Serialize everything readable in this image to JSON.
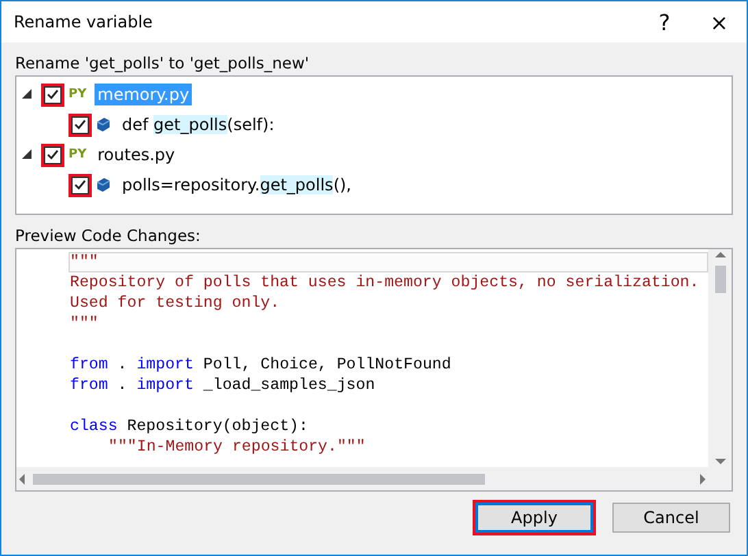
{
  "window": {
    "title": "Rename variable",
    "help": "?",
    "close": "×"
  },
  "rename_label": "Rename 'get_polls' to 'get_polls_new'",
  "tree": [
    {
      "name": "memory.py",
      "badge": "PY",
      "expanded": true,
      "checked": true,
      "highlighted": true,
      "selected": true,
      "children": [
        {
          "before": "def ",
          "match": "get_polls",
          "after": "(self):",
          "checked": true,
          "highlighted": true
        }
      ]
    },
    {
      "name": "routes.py",
      "badge": "PY",
      "expanded": true,
      "checked": true,
      "highlighted": true,
      "selected": false,
      "children": [
        {
          "before": "polls=repository.",
          "match": "get_polls",
          "after": "(),",
          "checked": true,
          "highlighted": true
        }
      ]
    }
  ],
  "preview_label": "Preview Code Changes:",
  "code_lines": [
    {
      "current": true,
      "tokens": [
        {
          "kind": "string",
          "text": "\"\"\""
        }
      ]
    },
    {
      "current": false,
      "tokens": [
        {
          "kind": "string",
          "text": "Repository of polls that uses in-memory objects, no serialization."
        }
      ]
    },
    {
      "current": false,
      "tokens": [
        {
          "kind": "string",
          "text": "Used for testing only."
        }
      ]
    },
    {
      "current": false,
      "tokens": [
        {
          "kind": "string",
          "text": "\"\"\""
        }
      ]
    },
    {
      "current": false
    },
    {
      "current": false,
      "tokens": [
        {
          "kind": "keyword",
          "text": "from"
        },
        {
          "kind": "plain",
          "text": " . "
        },
        {
          "kind": "keyword",
          "text": "import"
        },
        {
          "kind": "plain",
          "text": " Poll, Choice, PollNotFound"
        }
      ]
    },
    {
      "current": false,
      "tokens": [
        {
          "kind": "keyword",
          "text": "from"
        },
        {
          "kind": "plain",
          "text": " . "
        },
        {
          "kind": "keyword",
          "text": "import"
        },
        {
          "kind": "plain",
          "text": " _load_samples_json"
        }
      ]
    },
    {
      "current": false
    },
    {
      "current": false,
      "tokens": [
        {
          "kind": "keyword",
          "text": "class"
        },
        {
          "kind": "plain",
          "text": " Repository(object):"
        }
      ],
      "children": [
        {
          "current": false,
          "tokens": [
            {
              "kind": "string",
              "text": "\"\"\"In-Memory repository.\"\"\""
            }
          ]
        }
      ]
    }
  ],
  "buttons": [
    {
      "label": "Apply",
      "default": true,
      "highlighted": true
    },
    {
      "label": "Cancel",
      "default": false,
      "highlighted": false
    }
  ]
}
